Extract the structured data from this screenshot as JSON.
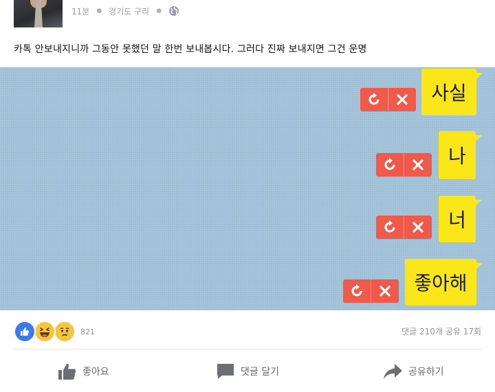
{
  "header": {
    "time": "11분",
    "location": "경기도 구리"
  },
  "post": {
    "text": "카톡 안보내지니까 그동안 못했던 말 한번 보내봅시다. 그러다 진짜 보내지면 그건 운명"
  },
  "chat": {
    "messages": [
      {
        "text": "사실"
      },
      {
        "text": "나"
      },
      {
        "text": "너"
      },
      {
        "text": "좋아해"
      }
    ]
  },
  "reactions": {
    "count": "821",
    "stats": "댓글 210개 공유 17회"
  },
  "actions": {
    "like_label": "좋아요",
    "comment_label": "댓글 달기",
    "share_label": "공유하기"
  },
  "colors": {
    "chat_background": "#9ebfd6",
    "bubble": "#fbe619",
    "failed_badge": "#f05a4b",
    "like_blue": "#3b7de8"
  }
}
